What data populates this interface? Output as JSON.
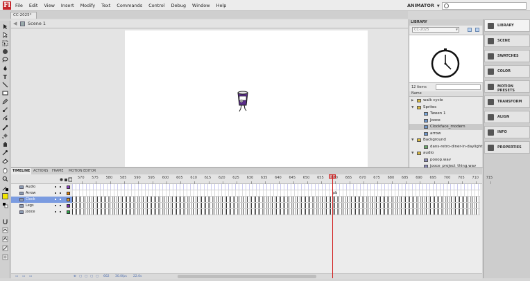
{
  "menubar": {
    "logo": "Fl",
    "items": [
      "File",
      "Edit",
      "View",
      "Insert",
      "Modify",
      "Text",
      "Commands",
      "Control",
      "Debug",
      "Window",
      "Help"
    ],
    "workspace": "ANIMATOR",
    "workspace_icon": "chevron-down-icon",
    "search_icon": "search-icon"
  },
  "document": {
    "tab_label": "CC-2025*",
    "scene_label": "Scene 1"
  },
  "tools": [
    "selection",
    "subselection",
    "free-transform",
    "gradient-transform",
    "lasso",
    "pen",
    "text",
    "line",
    "rectangle",
    "pencil",
    "brush",
    "deco",
    "bone",
    "paint-bucket",
    "ink-bottle",
    "eyedropper",
    "eraser",
    "hand",
    "zoom",
    "stroke-color",
    "fill-color",
    "swap-colors",
    "snap-to-objects",
    "smooth",
    "straighten"
  ],
  "colors": {
    "accent": "#7a9be0",
    "playhead": "#d21e1e",
    "stroke_swatch": "#000000",
    "fill_swatch": "#f2e600"
  },
  "library": {
    "tab": "LIBRARY",
    "doc_select": "CC-2025",
    "item_count": "12 items",
    "column_name": "Name",
    "items": [
      {
        "label": "walk cycle",
        "type": "folder",
        "depth": 0,
        "expanded": false
      },
      {
        "label": "Sprites",
        "type": "folder",
        "depth": 0,
        "expanded": true
      },
      {
        "label": "Tween 1",
        "type": "graphic",
        "depth": 1
      },
      {
        "label": "Jooce",
        "type": "movieclip",
        "depth": 1
      },
      {
        "label": "Clockface_modern",
        "type": "movieclip",
        "depth": 1,
        "selected": true
      },
      {
        "label": "arrow",
        "type": "movieclip",
        "depth": 1
      },
      {
        "label": "Background",
        "type": "folder",
        "depth": 0,
        "expanded": true
      },
      {
        "label": "dans-retro-diner-in-daylight",
        "type": "bitmap",
        "depth": 1
      },
      {
        "label": "audio",
        "type": "folder",
        "depth": 0,
        "expanded": true
      },
      {
        "label": "pooop.wav",
        "type": "sound",
        "depth": 1
      },
      {
        "label": "jooce_project_thing.wav",
        "type": "sound",
        "depth": 1
      }
    ]
  },
  "panels": [
    "LIBRARY",
    "SCENE",
    "SWATCHES",
    "COLOR",
    "MOTION PRESETS",
    "TRANSFORM",
    "ALIGN",
    "INFO",
    "PROPERTIES"
  ],
  "timeline": {
    "tabs": [
      "TIMELINE",
      "ACTIONS",
      "FRAME",
      "MOTION EDITOR"
    ],
    "ruler": [
      "570",
      "575",
      "580",
      "585",
      "590",
      "595",
      "600",
      "605",
      "610",
      "615",
      "620",
      "625",
      "630",
      "635",
      "640",
      "645",
      "650",
      "655",
      "660",
      "665",
      "670",
      "675",
      "680",
      "685",
      "690",
      "695",
      "700",
      "705",
      "710",
      "715"
    ],
    "current_frame": 662,
    "frame_label": "pb",
    "layers": [
      {
        "name": "Audio",
        "color": "#8b3fc9",
        "kind": "audio"
      },
      {
        "name": "Arrow",
        "color": "#e07f00",
        "kind": "plain"
      },
      {
        "name": "Clock",
        "color": "#e39b2a",
        "kind": "filled",
        "selected": true
      },
      {
        "name": "Legs",
        "color": "#7a2ea9",
        "kind": "filled"
      },
      {
        "name": "Jooce",
        "color": "#2ca74a",
        "kind": "filled"
      }
    ],
    "footer": {
      "frame": "662",
      "fps": "30.0fps",
      "time": "22.0s"
    }
  }
}
